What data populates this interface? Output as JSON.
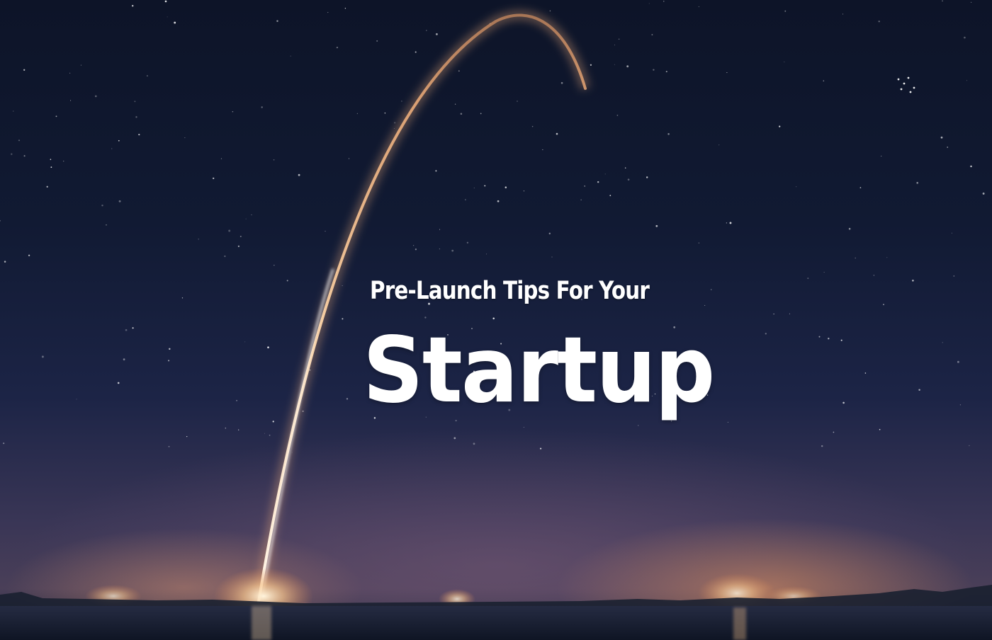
{
  "hero": {
    "tagline": "Pre-Launch Tips For Your",
    "title": "Startup"
  },
  "colors": {
    "sky_top": "#0d1428",
    "sky_horizon": "#4a3f58",
    "glow": "#e6965f",
    "text": "#ffffff",
    "water": "#141c2e"
  }
}
